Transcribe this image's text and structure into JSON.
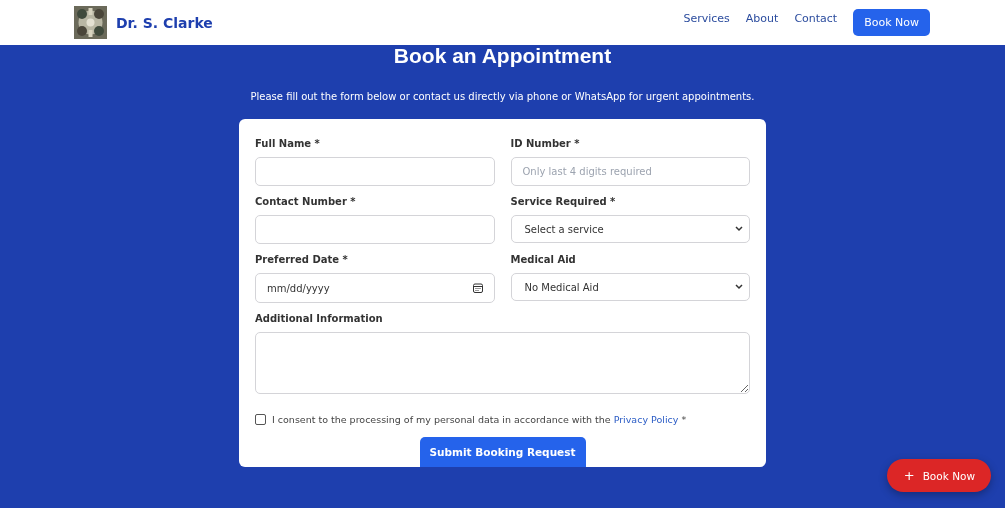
{
  "header": {
    "brand": "Dr. S. Clarke",
    "nav": [
      "Services",
      "About",
      "Contact"
    ],
    "cta": "Book Now"
  },
  "title": "Book an Appointment",
  "subtitle": "Please fill out the form below or contact us directly via phone or WhatsApp for urgent appointments.",
  "fields": [
    {
      "kind": "text",
      "label": "Full Name *"
    },
    {
      "kind": "text",
      "label": "ID Number *",
      "placeholder": "Only last 4 digits required"
    },
    {
      "kind": "text",
      "label": "Contact Number *"
    },
    {
      "kind": "select",
      "label": "Service Required *",
      "value": "Select a service"
    },
    {
      "kind": "date",
      "label": "Preferred Date *",
      "placeholder": "mm/dd/yyyy"
    },
    {
      "kind": "select",
      "label": "Medical Aid",
      "value": "No Medical Aid"
    },
    {
      "kind": "textarea",
      "label": "Additional Information"
    }
  ],
  "consent": {
    "checked": false,
    "text": "I consent to the processing of my personal data in accordance with the",
    "link": "Privacy Policy",
    "suffix": "*"
  },
  "submit": "Submit Booking Request",
  "floating_button": {
    "icon": "+",
    "label": "Book Now"
  }
}
